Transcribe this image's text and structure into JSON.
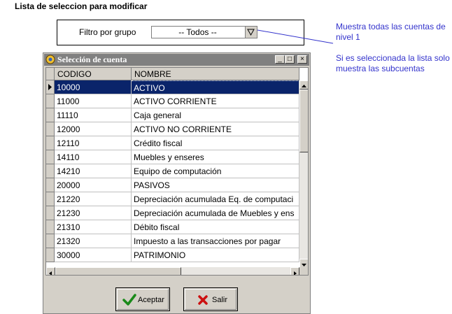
{
  "page": {
    "title": "Lista de seleccion para modificar"
  },
  "filter": {
    "label": "Filtro por grupo",
    "value": "-- Todos  --"
  },
  "annotations": {
    "note1": "Muestra todas las cuentas de nivel 1",
    "note2": "Si es seleccionada la lista solo muestra las subcuentas",
    "color": "#3333cc"
  },
  "window": {
    "title": "Selección de cuenta",
    "controls": [
      "_",
      "□",
      "×"
    ],
    "titlebar_color": "#808080"
  },
  "grid": {
    "columns": [
      "CODIGO",
      "NOMBRE"
    ],
    "selected_row": 0,
    "selection_color": "#0a246a",
    "rows": [
      [
        "10000",
        "ACTIVO"
      ],
      [
        "11000",
        "ACTIVO CORRIENTE"
      ],
      [
        "11110",
        "Caja general"
      ],
      [
        "12000",
        "ACTIVO NO CORRIENTE"
      ],
      [
        "12110",
        "Crédito fiscal"
      ],
      [
        "14110",
        "Muebles y enseres"
      ],
      [
        "14210",
        "Equipo de computación"
      ],
      [
        "20000",
        "PASIVOS"
      ],
      [
        "21220",
        "Depreciación acumulada Eq. de computaci"
      ],
      [
        "21230",
        "Depreciación acumulada de Muebles y ens"
      ],
      [
        "21310",
        "Débito fiscal"
      ],
      [
        "21320",
        "Impuesto a las transacciones por pagar"
      ],
      [
        "30000",
        "PATRIMONIO"
      ]
    ]
  },
  "buttons": {
    "accept": {
      "label": "Aceptar",
      "icon": "check-icon"
    },
    "exit": {
      "label": "Salir",
      "icon": "x-icon"
    }
  }
}
